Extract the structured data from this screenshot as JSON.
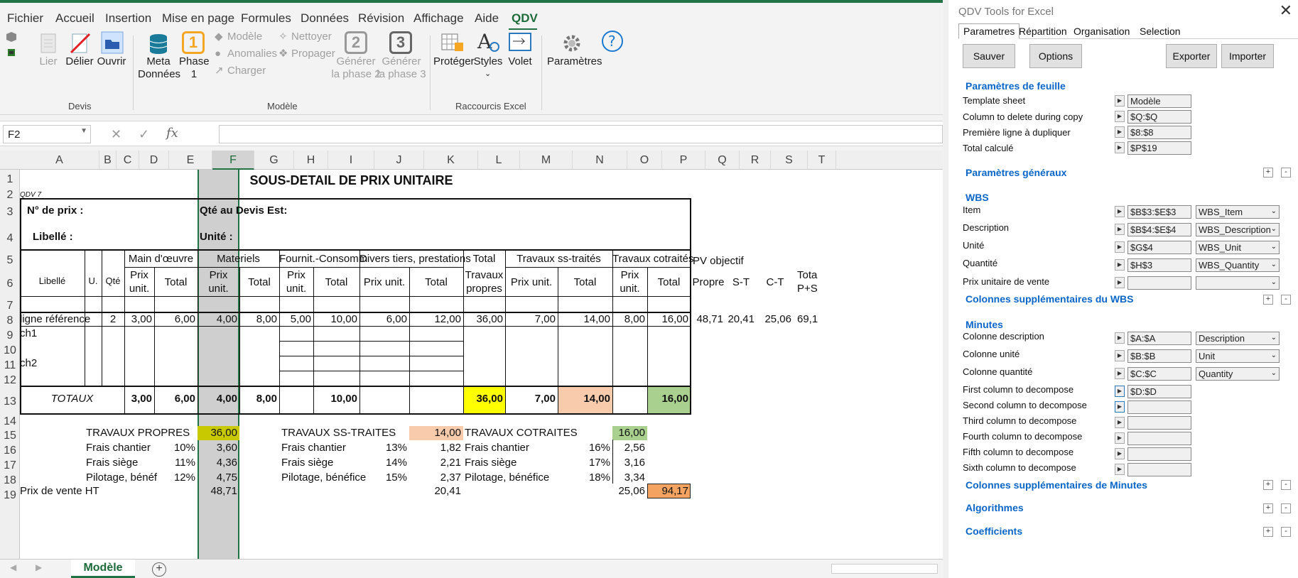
{
  "menu": [
    "Fichier",
    "Accueil",
    "Insertion",
    "Mise en page",
    "Formules",
    "Données",
    "Révision",
    "Affichage",
    "Aide",
    "QDV"
  ],
  "ribbon": {
    "devis": {
      "lier": "Lier",
      "delier": "Délier",
      "ouvrir": "Ouvrir",
      "group": "Devis"
    },
    "meta": {
      "line1": "Meta",
      "line2": "Données"
    },
    "phase1": {
      "num": "1",
      "line1": "Phase",
      "line2": "1"
    },
    "modele": {
      "modele": "Modèle",
      "anomalies": "Anomalies",
      "charger": "Charger",
      "nettoyer": "Nettoyer",
      "propager": "Propager",
      "group": "Modèle"
    },
    "phase2": {
      "num": "2",
      "line1": "Générer",
      "line2": "la phase 2"
    },
    "phase3": {
      "num": "3",
      "line1": "Générer",
      "line2": "la phase 3"
    },
    "raccourcis": {
      "proteger": "Protéger",
      "styles": "Styles",
      "volet": "Volet",
      "group": "Raccourcis Excel"
    },
    "parametres": "Paramètres"
  },
  "formula": {
    "namebox": "F2",
    "fx": "fx"
  },
  "columns": [
    "A",
    "B",
    "C",
    "D",
    "E",
    "F",
    "G",
    "H",
    "I",
    "J",
    "K",
    "L",
    "M",
    "N",
    "O",
    "P",
    "Q",
    "R",
    "S",
    "T"
  ],
  "rows": [
    "1",
    "2",
    "3",
    "4",
    "5",
    "6",
    "7",
    "8",
    "9",
    "10",
    "11",
    "12",
    "13",
    "14",
    "15",
    "16",
    "17",
    "18",
    "19"
  ],
  "sheet": {
    "title": "SOUS-DETAIL DE PRIX UNITAIRE",
    "qdv": "QDV 7",
    "no_prix": "N° de prix :",
    "libelle_lbl": "Libellé :",
    "qte_devis": "Qté au Devis Est:",
    "unite": "Unité :",
    "hdr_main": "Main d'œuvre",
    "hdr_mat": "Materiels",
    "hdr_fourn": "Fournit.-Consomm",
    "hdr_divers": "Divers tiers, prestations",
    "hdr_total": "Total",
    "hdr_travaux": "Travaux",
    "hdr_propres": "propres",
    "hdr_sst": "Travaux ss-traités",
    "hdr_cot": "Travaux cotraités",
    "hdr_pv": "PV objectif",
    "h_libelle": "Libellé",
    "h_u": "U.",
    "h_qte": "Qté",
    "h_prix": "Prix",
    "h_unit": "unit.",
    "h_total": "Total",
    "h_prixunit": "Prix unit.",
    "h_propre": "Propre",
    "h_st": "S-T",
    "h_ct": "C-T",
    "h_tota": "Tota",
    "h_ps": "P+S",
    "row8": {
      "a": "ligne référence",
      "c": "2",
      "d": "3,00",
      "e": "6,00",
      "f": "4,00",
      "g": "8,00",
      "h": "5,00",
      "i": "10,00",
      "j": "6,00",
      "k": "12,00",
      "l": "36,00",
      "m": "7,00",
      "n": "14,00",
      "o": "8,00",
      "p": "16,00",
      "q": "48,71",
      "r": "20,41",
      "s": "25,06",
      "t": "69,1"
    },
    "ch1": "ch1",
    "ch2": "ch2",
    "row13": {
      "a": "TOTAUX",
      "d": "3,00",
      "e": "6,00",
      "f": "4,00",
      "g": "8,00",
      "i": "10,00",
      "l": "36,00",
      "m": "7,00",
      "n": "14,00",
      "p": "16,00"
    },
    "r15": {
      "b": "TRAVAUX PROPRES",
      "f": "36,00",
      "h": "TRAVAUX SS-TRAITES",
      "k": "14,00",
      "l": "TRAVAUX COTRAITES",
      "o": "16,00"
    },
    "r16": {
      "b": "Frais chantier",
      "e": "10%",
      "f": "3,60",
      "h": "Frais chantier",
      "j": "13%",
      "k": "1,82",
      "l": "Frais chantier",
      "n": "16%",
      "o": "2,56"
    },
    "r17": {
      "b": "Frais siège",
      "e": "11%",
      "f": "4,36",
      "h": "Frais siège",
      "j": "14%",
      "k": "2,21",
      "l": "Frais siège",
      "n": "17%",
      "o": "3,16"
    },
    "r18": {
      "b": "Pilotage, bénéf",
      "e": "12%",
      "f": "4,75",
      "h": "Pilotage, bénéfice",
      "j": "15%",
      "k": "2,37",
      "l": "Pilotage, bénéfice",
      "n": "18%",
      "o": "3,34"
    },
    "r19": {
      "a": "Prix de vente HT",
      "f": "48,71",
      "k": "20,41",
      "o": "25,06",
      "p": "94,17"
    }
  },
  "sheet_tab": "Modèle",
  "panel": {
    "title": "QDV Tools for Excel",
    "tabs": [
      "Parametres",
      "Répartition",
      "Organisation",
      "Selection"
    ],
    "buttons": {
      "sauver": "Sauver",
      "options": "Options",
      "exporter": "Exporter",
      "importer": "Importer"
    },
    "sec_feuille": "Paramètres de feuille",
    "feuille": [
      {
        "label": "Template sheet",
        "value": "Modèle"
      },
      {
        "label": "Column to delete during copy",
        "value": "$Q:$Q"
      },
      {
        "label": "Première ligne à dupliquer",
        "value": "$8:$8"
      },
      {
        "label": "Total calculé",
        "value": "$P$19"
      }
    ],
    "sec_generaux": "Paramètres généraux",
    "sec_wbs": "WBS",
    "wbs": [
      {
        "label": "Item",
        "value": "$B$3:$E$3",
        "sel": "WBS_Item"
      },
      {
        "label": "Description",
        "value": "$B$4:$E$4",
        "sel": "WBS_Description"
      },
      {
        "label": "Unité",
        "value": "$G$4",
        "sel": "WBS_Unit"
      },
      {
        "label": "Quantité",
        "value": "$H$3",
        "sel": "WBS_Quantity"
      },
      {
        "label": "Prix unitaire de vente",
        "value": "",
        "sel": ""
      }
    ],
    "sec_wbs_sup": "Colonnes supplémentaires du WBS",
    "sec_minutes": "Minutes",
    "minutes": [
      {
        "label": "Colonne description",
        "value": "$A:$A",
        "sel": "Description"
      },
      {
        "label": "Colonne unité",
        "value": "$B:$B",
        "sel": "Unit"
      },
      {
        "label": "Colonne quantité",
        "value": "$C:$C",
        "sel": "Quantity"
      },
      {
        "label": "First column to decompose",
        "value": "$D:$D"
      },
      {
        "label": "Second column to decompose",
        "value": ""
      },
      {
        "label": "Third column to decompose",
        "value": ""
      },
      {
        "label": "Fourth column to decompose",
        "value": ""
      },
      {
        "label": "Fifth column to decompose",
        "value": ""
      },
      {
        "label": "Sixth column to decompose",
        "value": ""
      }
    ],
    "sec_min_sup": "Colonnes supplémentaires de Minutes",
    "sec_algo": "Algorithmes",
    "sec_coef": "Coefficients"
  },
  "colors": {
    "yellow": "#ffff00",
    "salmon": "#f8cbad",
    "green": "#a9d08e",
    "olive": "#c9c900",
    "orange": "#f4a460",
    "accent": "#217346"
  }
}
